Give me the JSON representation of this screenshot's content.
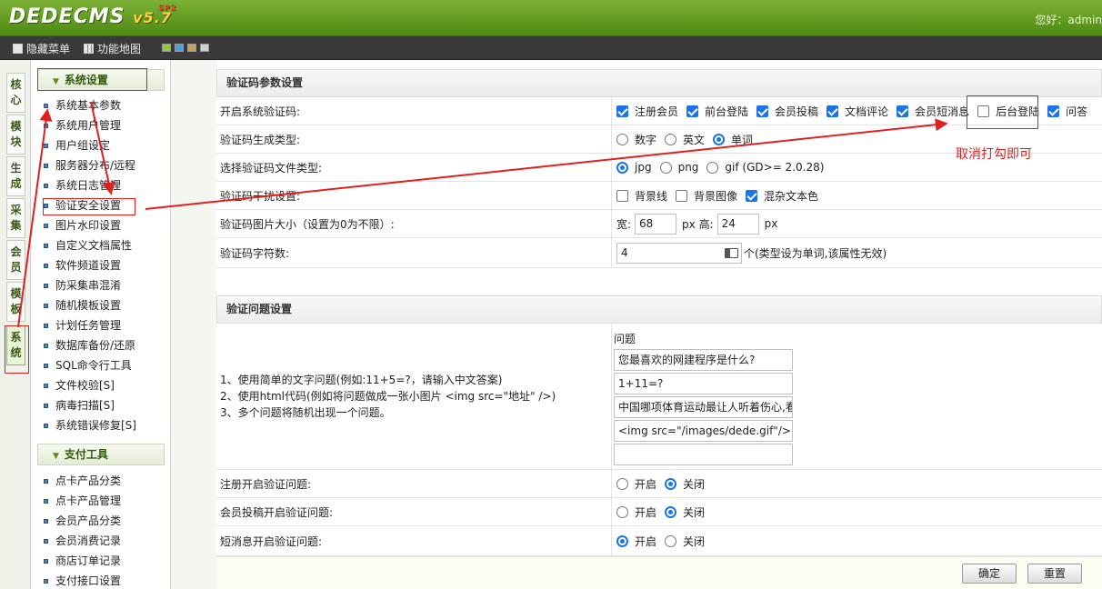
{
  "header": {
    "logo_text": "DEDECMS",
    "logo_version": "v5.7",
    "logo_tag": "SP2",
    "greeting": "您好：admin"
  },
  "toolbar": {
    "hide_menu": "隐藏菜单",
    "function_map": "功能地图"
  },
  "vtabs": [
    {
      "label": "核心"
    },
    {
      "label": "模块"
    },
    {
      "label": "生成"
    },
    {
      "label": "采集"
    },
    {
      "label": "会员"
    },
    {
      "label": "模板"
    },
    {
      "label": "系统"
    }
  ],
  "sidebar": {
    "system_title": "系统设置",
    "system_items": [
      "系统基本参数",
      "系统用户管理",
      "用户组设定",
      "服务器分布/远程",
      "系统日志管理",
      "验证安全设置",
      "图片水印设置",
      "自定义文档属性",
      "软件频道设置",
      "防采集串混淆",
      "随机模板设置",
      "计划任务管理",
      "数据库备份/还原",
      "SQL命令行工具",
      "文件校验[S]",
      "病毒扫描[S]",
      "系统错误修复[S]"
    ],
    "pay_title": "支付工具",
    "pay_items": [
      "点卡产品分类",
      "点卡产品管理",
      "会员产品分类",
      "会员消费记录",
      "商店订单记录",
      "支付接口设置"
    ]
  },
  "captcha": {
    "section_title": "验证码参数设置",
    "enable_label": "开启系统验证码:",
    "enable_options": [
      {
        "label": "注册会员",
        "checked": true
      },
      {
        "label": "前台登陆",
        "checked": true
      },
      {
        "label": "会员投稿",
        "checked": true
      },
      {
        "label": "文档评论",
        "checked": true
      },
      {
        "label": "会员短消息",
        "checked": true
      },
      {
        "label": "后台登陆",
        "checked": false
      },
      {
        "label": "问答",
        "checked": true
      }
    ],
    "gen_type_label": "验证码生成类型:",
    "gen_type_options": [
      {
        "label": "数字",
        "checked": false
      },
      {
        "label": "英文",
        "checked": false
      },
      {
        "label": "单词",
        "checked": true
      }
    ],
    "file_type_label": "选择验证码文件类型:",
    "file_type_options": [
      {
        "label": "jpg",
        "checked": true
      },
      {
        "label": "png",
        "checked": false
      },
      {
        "label": "gif (GD>= 2.0.28)",
        "checked": false
      }
    ],
    "noise_label": "验证码干扰设置:",
    "noise_options": [
      {
        "label": "背景线",
        "checked": false
      },
      {
        "label": "背景图像",
        "checked": false
      },
      {
        "label": "混杂文本色",
        "checked": true
      }
    ],
    "size_label": "验证码图片大小（设置为0为不限）:",
    "width_label": "宽:",
    "width_value": "68",
    "height_label": "px 高:",
    "height_value": "24",
    "px_unit": "px",
    "chars_label": "验证码字符数:",
    "chars_value": "4",
    "chars_note": "个(类型设为单词,该属性无效)"
  },
  "question": {
    "section_title": "验证问题设置",
    "help_lines": [
      "1、使用简单的文字问题(例如:11+5=?，请输入中文答案)",
      "2、使用html代码(例如将问题做成一张小图片 <img src=\"地址\" />)",
      "3、多个问题将随机出现一个问题。"
    ],
    "questions_title": "问题",
    "questions": [
      "您最喜欢的网建程序是什么?",
      "1+11=?",
      "中国哪项体育运动最让人听着伤心,看着",
      "<img src=\"/images/dede.gif\"/>",
      ""
    ],
    "reg_label": "注册开启验证问题:",
    "reg_options": [
      {
        "label": "开启",
        "checked": false
      },
      {
        "label": "关闭",
        "checked": true
      }
    ],
    "post_label": "会员投稿开启验证问题:",
    "post_options": [
      {
        "label": "开启",
        "checked": false
      },
      {
        "label": "关闭",
        "checked": true
      }
    ],
    "pm_label": "短消息开启验证问题:",
    "pm_options": [
      {
        "label": "开启",
        "checked": true
      },
      {
        "label": "关闭",
        "checked": false
      }
    ]
  },
  "buttons": {
    "ok": "确定",
    "reset": "重置"
  },
  "annotation": {
    "note": "取消打勾即可",
    "color": "#e02020"
  }
}
